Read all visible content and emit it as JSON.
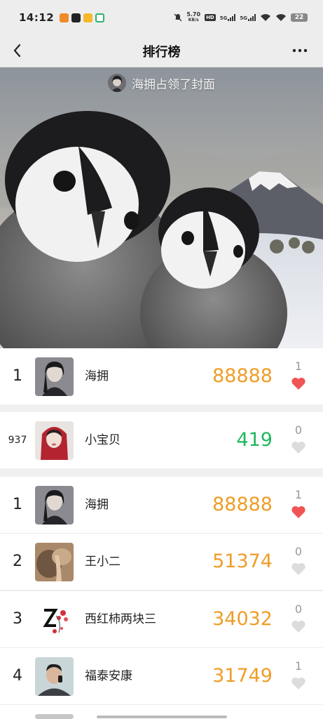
{
  "status_bar": {
    "time": "14:12",
    "net_speed": "5.70",
    "net_unit": "KB/s",
    "hd": "HD",
    "sim1": "5G",
    "sim2": "5G",
    "battery": "22"
  },
  "nav": {
    "title": "排行榜",
    "back_icon": "back-arrow-icon",
    "more_icon": "more-dots-icon"
  },
  "cover": {
    "caption": "海拥占领了封面"
  },
  "top_entry": {
    "rank": "1",
    "name": "海拥",
    "score": "88888",
    "likes": "1",
    "liked": true
  },
  "my_entry": {
    "rank": "937",
    "name": "小宝贝",
    "score": "419",
    "likes": "0",
    "liked": false
  },
  "ranking": [
    {
      "rank": "1",
      "name": "海拥",
      "score": "88888",
      "likes": "1",
      "liked": true
    },
    {
      "rank": "2",
      "name": "王小二",
      "score": "51374",
      "likes": "0",
      "liked": false
    },
    {
      "rank": "3",
      "name": "西红柿两块三",
      "score": "34032",
      "likes": "0",
      "liked": false
    },
    {
      "rank": "4",
      "name": "福泰安康",
      "score": "31749",
      "likes": "1",
      "liked": false
    }
  ],
  "colors": {
    "score_orange": "#ef9d28",
    "score_green": "#1fb85c",
    "heart_active": "#f05454",
    "heart_inactive": "#dcdcdc"
  }
}
